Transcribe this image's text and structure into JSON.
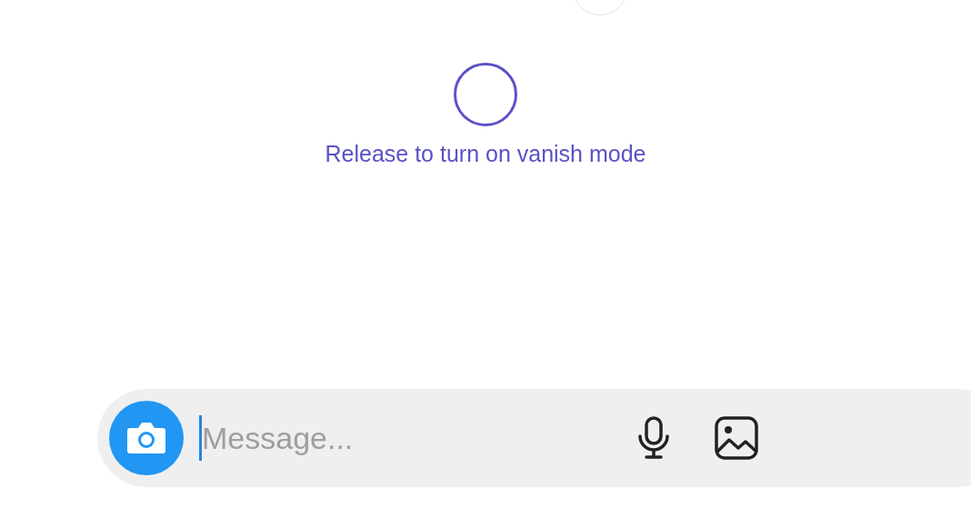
{
  "vanish_hint": {
    "text": "Release to turn on vanish mode"
  },
  "composer": {
    "placeholder": "Message..."
  }
}
